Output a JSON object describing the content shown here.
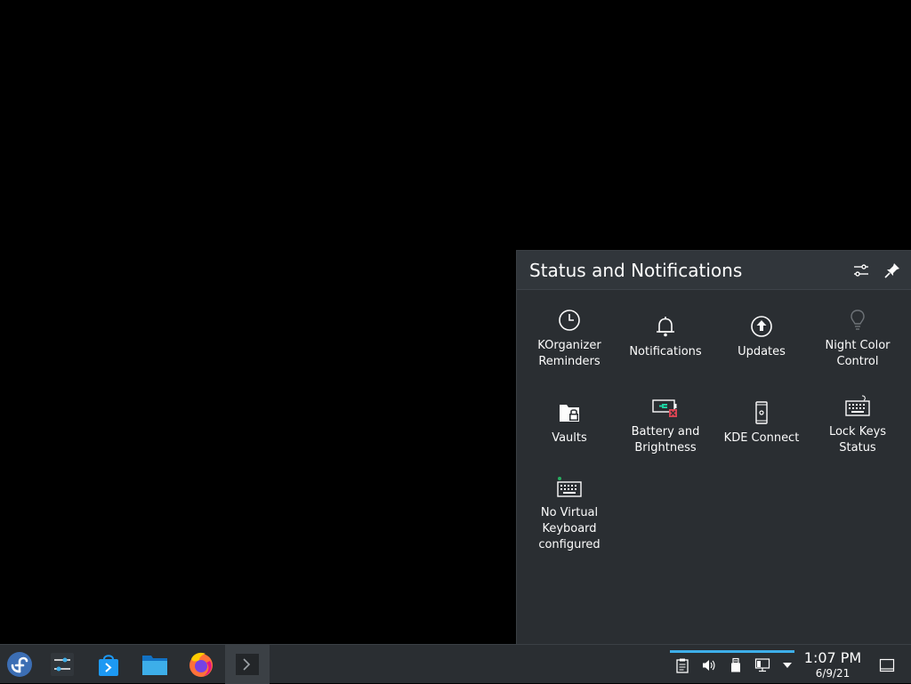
{
  "popup": {
    "title": "Status and Notifications",
    "header_icons": [
      "configure-icon",
      "pin-icon"
    ],
    "items": [
      {
        "label": "KOrganizer\nReminders",
        "icon": "clock-icon"
      },
      {
        "label": "Notifications",
        "icon": "bell-icon"
      },
      {
        "label": "Updates",
        "icon": "update-icon"
      },
      {
        "label": "Night Color\nControl",
        "icon": "lightbulb-icon"
      },
      {
        "label": "Vaults",
        "icon": "vault-icon"
      },
      {
        "label": "Battery and\nBrightness",
        "icon": "battery-icon"
      },
      {
        "label": "KDE Connect",
        "icon": "phone-icon"
      },
      {
        "label": "Lock Keys\nStatus",
        "icon": "keyboard-icon"
      },
      {
        "label": "No Virtual\nKeyboard\nconfigured",
        "icon": "virtual-keyboard-icon"
      }
    ]
  },
  "taskbar": {
    "launcher_icon": "fedora-launcher-icon",
    "tasks": [
      {
        "name": "system-settings",
        "icon": "settings-sliders-icon"
      },
      {
        "name": "discover",
        "icon": "shopping-bag-icon"
      },
      {
        "name": "dolphin",
        "icon": "folder-icon"
      },
      {
        "name": "firefox",
        "icon": "firefox-icon"
      },
      {
        "name": "konsole",
        "icon": "terminal-icon"
      }
    ],
    "tray_icons": [
      "clipboard-icon",
      "volume-icon",
      "usb-icon",
      "network-icon",
      "expand-arrow-icon"
    ],
    "clock": {
      "time": "1:07 PM",
      "date": "6/9/21"
    },
    "show_desktop_icon": "show-desktop-icon"
  },
  "colors": {
    "accent": "#3daee9",
    "panel": "#2a2e32",
    "header": "#31363b",
    "text": "#fcfcfc",
    "kde_connect_green": "#1dd1a1",
    "battery_red": "#da4453"
  }
}
